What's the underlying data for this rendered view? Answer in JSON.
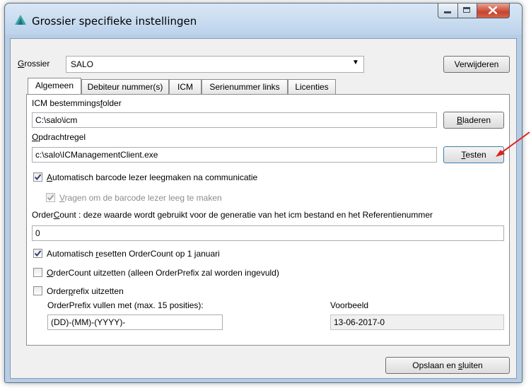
{
  "window": {
    "title": "Grossier specifieke instellingen",
    "minimize_icon": "minimize-icon",
    "maximize_icon": "maximize-icon",
    "close_icon": "close-icon",
    "close_color": "#c7442f"
  },
  "grossier": {
    "label_first": "G",
    "label_rest": "rossier",
    "selected": "SALO",
    "delete_button": "Verwijderen"
  },
  "tabs": [
    {
      "label": "Algemeen",
      "active": true
    },
    {
      "label": "Debiteur nummer(s)"
    },
    {
      "label": "ICM"
    },
    {
      "label": "Serienummer links"
    },
    {
      "label": "Licenties"
    }
  ],
  "icm": {
    "label_pre": "ICM bestemmings",
    "label_u": "f",
    "label_post": "older",
    "value": "C:\\salo\\icm",
    "browse_u": "B",
    "browse_rest": "laderen"
  },
  "command": {
    "label_u": "O",
    "label_rest": "pdrachtregel",
    "value": "c:\\salo\\ICManagementClient.exe",
    "test_u": "T",
    "test_rest": "esten",
    "arrow_color": "#e0201b"
  },
  "options": {
    "auto_clear_u": "A",
    "auto_clear_rest": "utomatisch barcode lezer leegmaken na communicatie",
    "auto_clear_checked": true,
    "ask_clear_u": "V",
    "ask_clear_rest": "ragen om de barcode lezer leeg te maken",
    "ask_clear_checked": true,
    "ordercount_label_pre": "Order",
    "ordercount_label_u": "C",
    "ordercount_label_post": "ount : deze waarde wordt gebruikt voor de generatie van het icm bestand en het Referentienummer",
    "ordercount_value": "0",
    "auto_reset_pre": "Automatisch ",
    "auto_reset_u": "r",
    "auto_reset_post": "esetten OrderCount op 1 januari",
    "auto_reset_checked": true,
    "oc_off_u": "O",
    "oc_off_rest": "rderCount uitzetten (alleen OrderPrefix zal worden ingevuld)",
    "oc_off_checked": false,
    "prefix_off_pre": "Order",
    "prefix_off_u": "p",
    "prefix_off_post": "refix uitzetten",
    "prefix_off_checked": false,
    "prefix_fill_label": "OrderPrefix vullen met (max. 15 posities):",
    "prefix_fill_value": "(DD)-(MM)-(YYYY)-",
    "example_label": "Voorbeeld",
    "example_value": "13-06-2017-0"
  },
  "footer": {
    "save_pre": "Opslaan en ",
    "save_u": "s",
    "save_post": "luiten"
  }
}
